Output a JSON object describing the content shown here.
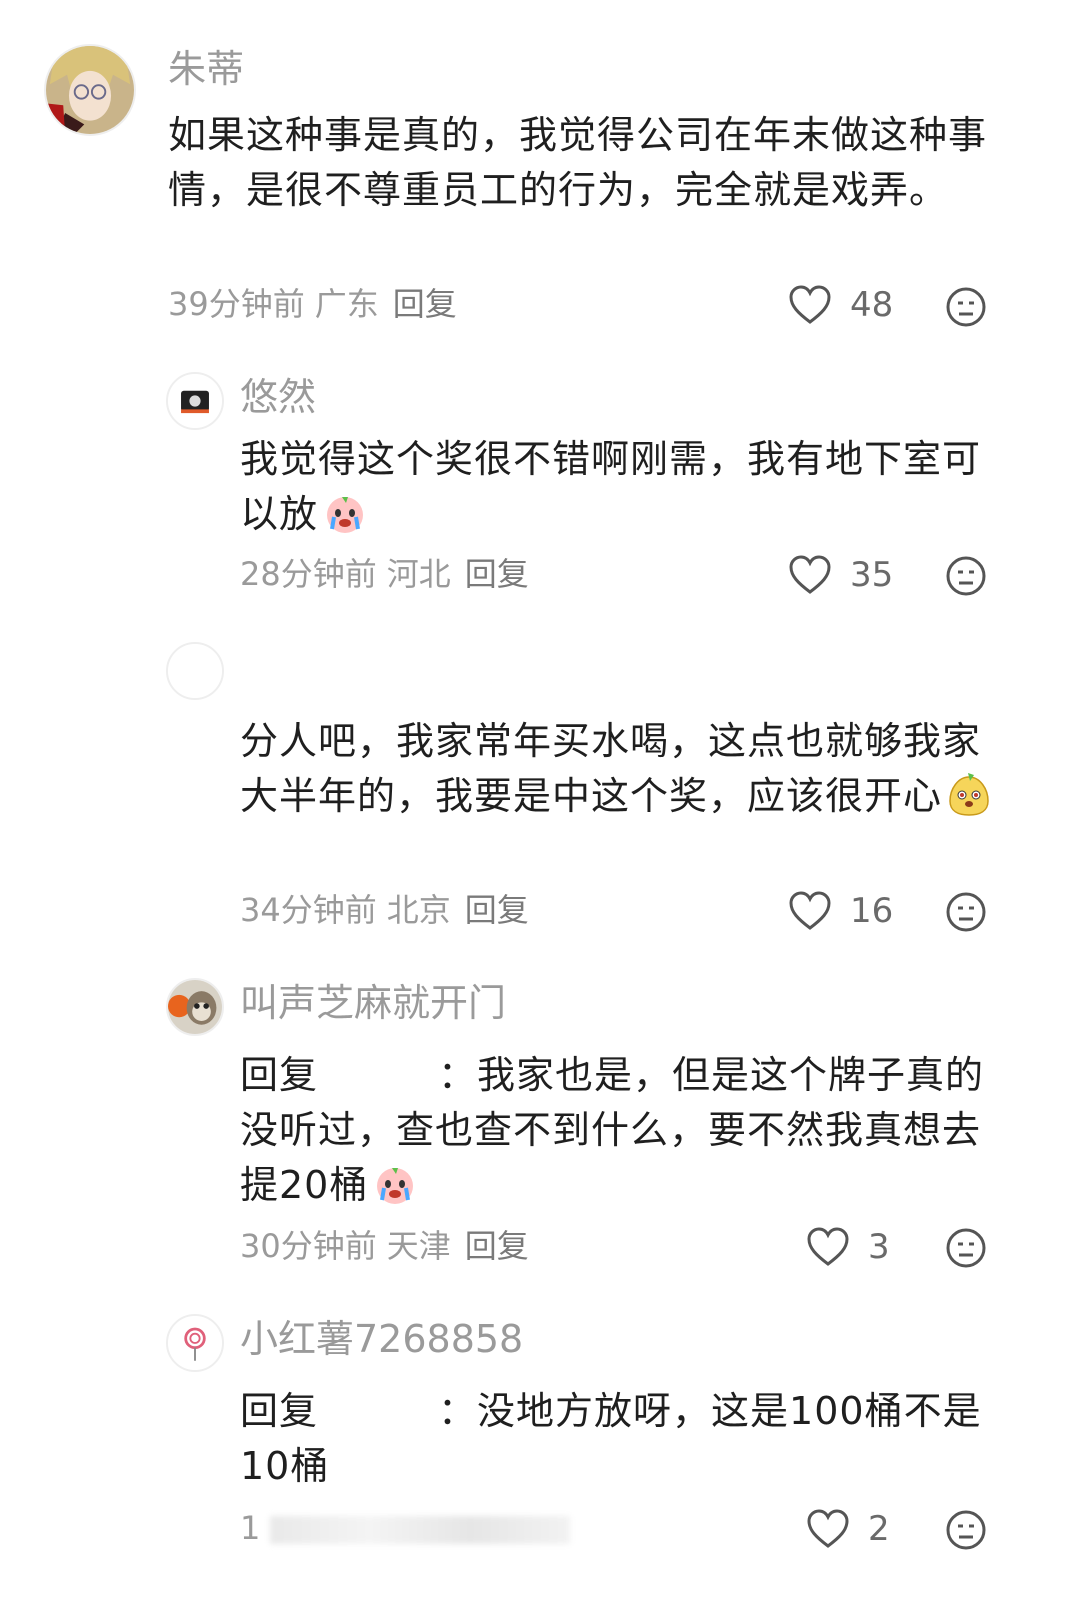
{
  "comments": [
    {
      "name": "朱蒂",
      "text": "如果这种事是真的，我觉得公司在年末做这种事情，是很不尊重员工的行为，完全就是戏弄。",
      "time": "39分钟前",
      "location": "广东",
      "reply_label": "回复",
      "likes": "48",
      "avatar_icon": "anime-avatar-icon"
    },
    {
      "name": "悠然",
      "text": "我觉得这个奖很不错啊刚需，我有地下室可以放",
      "emoji_icon": "crying-peach-emoji-icon",
      "time": "28分钟前",
      "location": "河北",
      "reply_label": "回复",
      "likes": "35",
      "avatar_icon": "camera-avatar-icon"
    },
    {
      "name": "",
      "text": "分人吧，我家常年买水喝，这点也就够我家大半年的，我要是中这个奖，应该很开心",
      "emoji_icon": "smiling-pear-emoji-icon",
      "time": "34分钟前",
      "location": "北京",
      "reply_label": "回复",
      "likes": "16",
      "avatar_icon": "blank-avatar-icon"
    },
    {
      "name": "叫声芝麻就开门",
      "reply_prefix": "回复",
      "separator": "：",
      "text": "我家也是，但是这个牌子真的没听过，查也查不到什么，要不然我真想去提20桶",
      "emoji_icon": "crying-peach-emoji-icon",
      "time": "30分钟前",
      "location": "天津",
      "reply_label": "回复",
      "likes": "3",
      "avatar_icon": "raccoon-avatar-icon"
    },
    {
      "name": "小红薯7268858",
      "reply_prefix": "回复",
      "separator": "：",
      "text": "没地方放呀，这是100桶不是10桶",
      "time": "1",
      "likes": "2",
      "avatar_icon": "lollipop-avatar-icon"
    }
  ],
  "colors": {
    "meta": "#9a9a9a",
    "text": "#1f1f1f",
    "icon": "#555555"
  }
}
